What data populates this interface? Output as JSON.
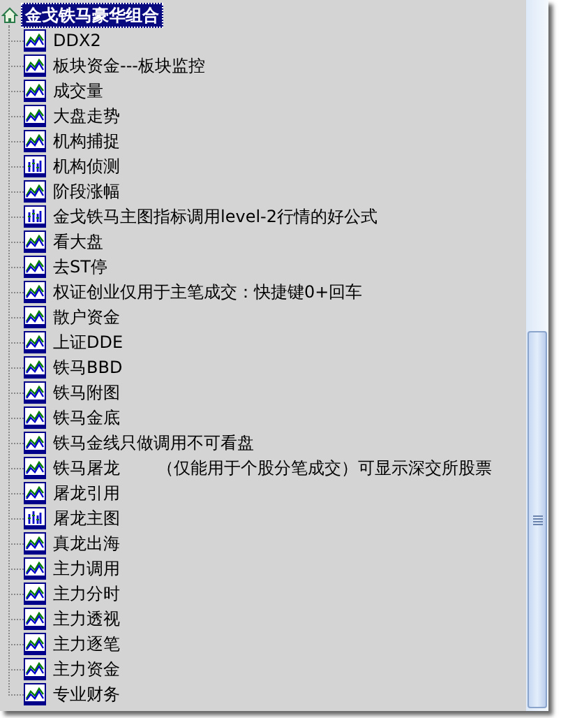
{
  "tree": {
    "label": "金戈铁马豪华组合",
    "selected": true,
    "children": [
      {
        "label": "DDX2",
        "kind": "line",
        "selected": false
      },
      {
        "label": "板块资金---板块监控",
        "kind": "line",
        "selected": false
      },
      {
        "label": "成交量",
        "kind": "line",
        "selected": false
      },
      {
        "label": "大盘走势",
        "kind": "line",
        "selected": false
      },
      {
        "label": "机构捕捉",
        "kind": "line",
        "selected": false
      },
      {
        "label": "机构侦测",
        "kind": "bars",
        "selected": false
      },
      {
        "label": "阶段涨幅",
        "kind": "line",
        "selected": false
      },
      {
        "label": "金戈铁马主图指标调用level-2行情的好公式",
        "kind": "bars",
        "selected": false
      },
      {
        "label": "看大盘",
        "kind": "line",
        "selected": false
      },
      {
        "label": "去ST停",
        "kind": "line",
        "selected": false
      },
      {
        "label": "权证创业仅用于主笔成交：快捷键0+回车",
        "kind": "line",
        "selected": false
      },
      {
        "label": "散户资金",
        "kind": "line",
        "selected": false
      },
      {
        "label": "上证DDE",
        "kind": "line",
        "selected": false
      },
      {
        "label": "铁马BBD",
        "kind": "line",
        "selected": false
      },
      {
        "label": "铁马附图",
        "kind": "line",
        "selected": false
      },
      {
        "label": "铁马金底",
        "kind": "line",
        "selected": false
      },
      {
        "label": "铁马金线只做调用不可看盘",
        "kind": "line",
        "selected": false
      },
      {
        "label": "铁马屠龙       （仅能用于个股分笔成交）可显示深交所股票",
        "kind": "line",
        "selected": false
      },
      {
        "label": "屠龙引用",
        "kind": "line",
        "selected": false
      },
      {
        "label": "屠龙主图",
        "kind": "bars",
        "selected": false
      },
      {
        "label": "真龙出海",
        "kind": "line",
        "selected": false
      },
      {
        "label": "主力调用",
        "kind": "line",
        "selected": false
      },
      {
        "label": "主力分时",
        "kind": "line",
        "selected": false
      },
      {
        "label": "主力透视",
        "kind": "line",
        "selected": false
      },
      {
        "label": "主力逐笔",
        "kind": "line",
        "selected": false
      },
      {
        "label": "主力资金",
        "kind": "line",
        "selected": false
      },
      {
        "label": "专业财务",
        "kind": "line",
        "selected": false
      }
    ]
  }
}
